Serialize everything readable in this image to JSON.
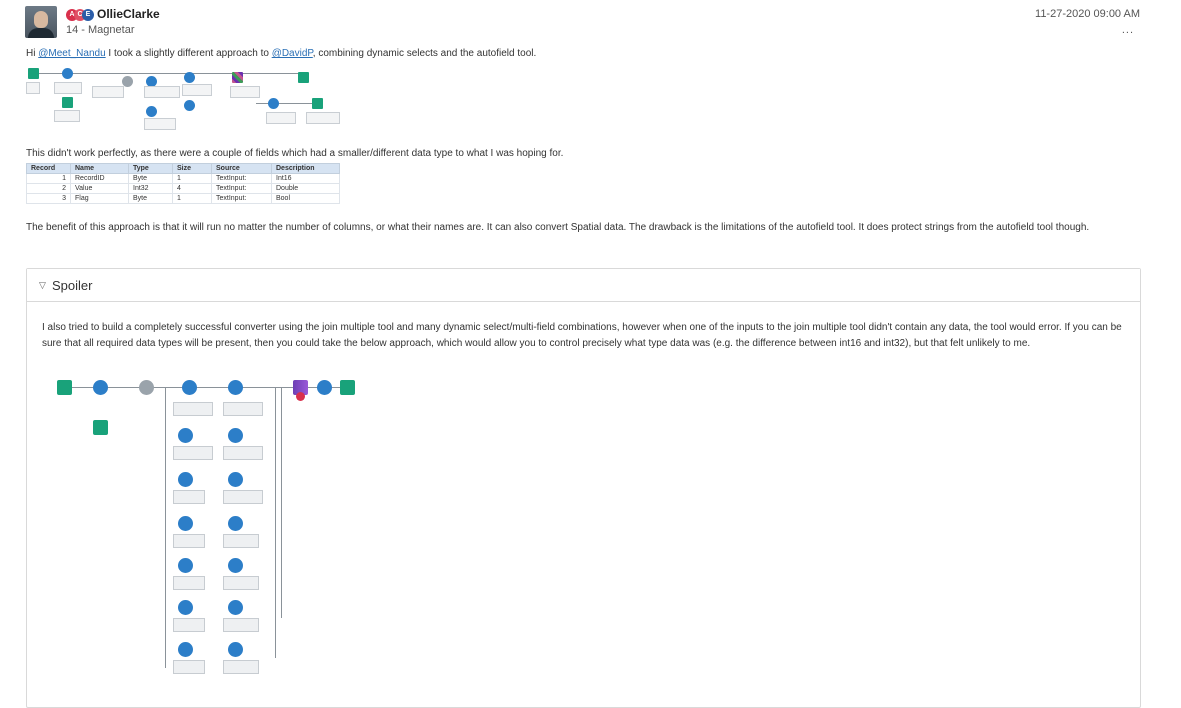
{
  "post": {
    "username": "OllieClarke",
    "ace_badge": [
      "A",
      "C",
      "E"
    ],
    "rank": "14 - Magnetar",
    "timestamp": "11-27-2020 09:00 AM",
    "more_label": "...",
    "intro": {
      "prefix": "Hi ",
      "mention1": "@Meet_Nandu",
      "middle": " I took a slightly different approach to ",
      "mention2": "@DavidP",
      "suffix": ", combining dynamic selects and the autofield tool."
    },
    "caveat": "This didn't work perfectly, as there were a couple of fields which had a smaller/different data type to what I was hoping for.",
    "benefit": "The benefit of this approach is that it will run no matter the number of columns, or what their names are. It can also convert Spatial data. The drawback is the limitations of the autofield tool. It does protect strings from the autofield tool though."
  },
  "table": {
    "headers": [
      "Record",
      "Name",
      "Type",
      "Size",
      "Source",
      "Description"
    ],
    "rows": [
      [
        "1",
        "RecordID",
        "Byte",
        "1",
        "TextInput:",
        "Int16"
      ],
      [
        "2",
        "Value",
        "Int32",
        "4",
        "TextInput:",
        "Double"
      ],
      [
        "3",
        "Flag",
        "Byte",
        "1",
        "TextInput:",
        "Bool"
      ]
    ]
  },
  "spoiler": {
    "title": "Spoiler",
    "toggle_icon": "triangle-down-icon",
    "body": "I also tried to build a completely successful converter using the join multiple tool and many dynamic select/multi-field combinations, however when one of the inputs to the join multiple tool didn't contain any data, the tool would error. If you can be sure that all required data types will be present, then you could take the below approach, which would allow you to control precisely what type data was (e.g. the difference between int16 and int32), but that felt unlikely to me."
  },
  "colors": {
    "link": "#2a6fb5",
    "table_header": "#d6e3f2",
    "tool_blue": "#2c7ec8",
    "tool_green": "#19a27a",
    "ace_red": "#d9304c"
  }
}
